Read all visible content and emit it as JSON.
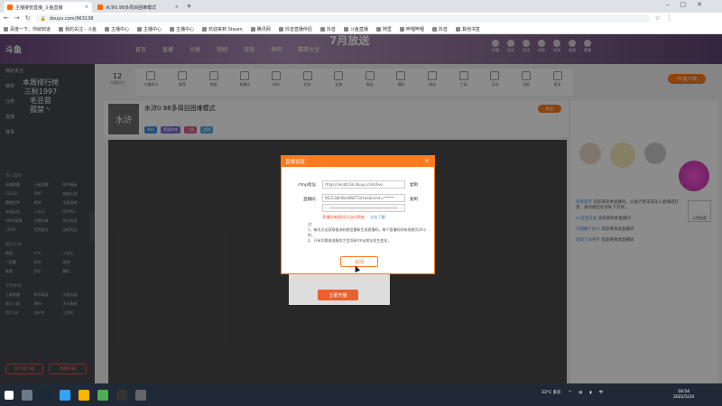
{
  "browser": {
    "tabs": [
      {
        "title": "主播接管直播_斗鱼直播",
        "active": true
      },
      {
        "title": "水浒0.98多周目困难模式",
        "active": false
      }
    ],
    "url": "douyu.com/963138",
    "bookmarks": [
      "百度一下，你就知道",
      "我的关注 - 斗鱼",
      "主播中心",
      "主播中心",
      "主播中心",
      "欢迎来到 Steam",
      "腾讯网",
      "抖音直播伴侣",
      "抖音",
      "斗鱼直播",
      "阿里",
      "哔哩哔哩",
      "抖音",
      "其他书签"
    ]
  },
  "header": {
    "logo": "斗鱼",
    "nav": [
      "首页",
      "直播",
      "分类",
      "视频",
      "游戏",
      "鱼吧",
      "赛事大全"
    ],
    "banner": "7月放送",
    "search_placeholder": "搜索",
    "right_icons": [
      "开播",
      "历史",
      "关注",
      "消息",
      "任务",
      "鱼翅",
      "客服"
    ]
  },
  "sidebar": {
    "items_top": [
      "我的关注",
      "推荐",
      "分类",
      "直播",
      "赛事"
    ],
    "overlay_lines": [
      "本周排行榜",
      "三秋1997",
      "毛豆苗",
      "孤禁丶"
    ],
    "section_hot": "热门游戏",
    "hot_games": [
      "英雄联盟",
      "王者荣耀",
      "和平精英",
      "CS:GO",
      "DNF",
      "穿越火线",
      "魔兽世界",
      "原神",
      "主机游戏",
      "永劫无间",
      "二次元",
      "DOTA2",
      "APEX英雄",
      "守望先锋",
      "炉石传说",
      "CFHD",
      "生死狙击",
      "战地风云"
    ],
    "section_entertain": "娱乐天地",
    "entertain": [
      "颜值",
      "户外",
      "二次元",
      "一起看",
      "科技",
      "鱼吧",
      "美食",
      "音乐",
      "舞蹈"
    ],
    "section_mobile": "手游休闲",
    "mobile": [
      "王者荣耀",
      "和平精英",
      "火影忍者",
      "第五人格",
      "原神",
      "天天象棋",
      "QQ飞车",
      "金铲铲",
      "三国杀"
    ],
    "buttons": [
      "客户端下载",
      "我要开播"
    ]
  },
  "room": {
    "stats_value": "12",
    "stats_label": "主播积分",
    "iconbar": [
      "主播积分",
      "推荐",
      "数据",
      "直播间",
      "装扮",
      "任务",
      "礼物",
      "赠送",
      "福利",
      "粉丝",
      "工具",
      "活动",
      "功能",
      "更多"
    ],
    "title": "水浒0.98多周目困难模式",
    "tags": [
      "单机",
      "策略游戏",
      "三国",
      "战棋"
    ],
    "avatar_text": "水浒",
    "pc_button": "PC客户端",
    "follow": "关注"
  },
  "chat": [
    {
      "user": "系统提示",
      "text": "欢迎来到本直播间，斗鱼严禁未成年人直播或打赏，请勿相信任何私下交易。"
    },
    {
      "user": "xx宝宝在此",
      "text": "欢迎来到本直播间"
    },
    {
      "user": "只想做个好人",
      "text": "欢迎来到本直播间"
    },
    {
      "user": "吃饱了没事干",
      "text": "欢迎来到本直播间"
    }
  ],
  "modal": {
    "title": "直播设置",
    "rtmp_label": "rtmp地址:",
    "rtmp_value": "rtmp://sendtc3a.douyu.com/live",
    "key_label": "直播码:",
    "key_value": "963138rtKkeNSPT5d?wsSecret=******",
    "copy": "复制",
    "warn": "直播码每隔30天自动更新",
    "link": "点击了解",
    "notes_title": "注:",
    "notes": [
      "1、每次点击获取推流码都会重新生成直播码，每个直播码的有效期为24小时。",
      "2、只有切换推流服务才会导致rtmp地址发生变化。"
    ],
    "ok": "关闭"
  },
  "bg_button": "立即开播",
  "taskbar": {
    "weather": "33°C 多云",
    "lang": "中",
    "time": "18:54",
    "date": "2022/5/24"
  },
  "right_extra": {
    "gift_label": "斗鱼抽奖"
  },
  "colors": {
    "brand": "#ff7a1a",
    "sidebar": "#44474e"
  }
}
